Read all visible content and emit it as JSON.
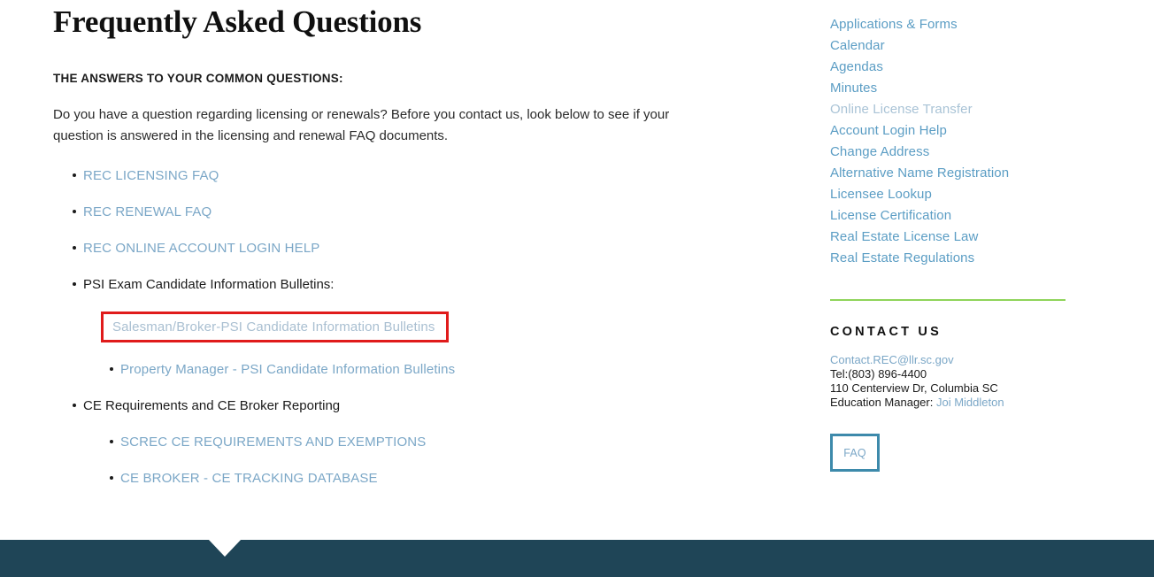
{
  "page": {
    "title": "Frequently Asked Questions",
    "subheading": "THE ANSWERS TO YOUR COMMON QUESTIONS:",
    "intro": "Do you have a question regarding licensing or renewals? Before you contact us, look below to see if your question is answered in the licensing and renewal FAQ documents."
  },
  "faq_list": [
    {
      "label": "REC LICENSING FAQ",
      "type": "link",
      "state": "normal"
    },
    {
      "label": "REC RENEWAL FAQ",
      "type": "link",
      "state": "normal"
    },
    {
      "label": "REC ONLINE ACCOUNT LOGIN HELP",
      "type": "link",
      "state": "normal"
    },
    {
      "label": "PSI Exam Candidate Information Bulletins:",
      "type": "text",
      "state": "normal"
    },
    {
      "label": "CE Requirements and CE Broker Reporting",
      "type": "text",
      "state": "normal"
    }
  ],
  "psi_sublist": [
    {
      "label": "Salesman/Broker-PSI Candidate Information Bulletins",
      "type": "link",
      "state": "muted",
      "highlighted": true
    },
    {
      "label": "Property Manager - PSI Candidate Information Bulletins",
      "type": "link",
      "state": "normal",
      "highlighted": false
    }
  ],
  "ce_sublist": [
    {
      "label": "SCREC CE REQUIREMENTS AND EXEMPTIONS",
      "type": "link",
      "state": "normal"
    },
    {
      "label": "CE BROKER - CE TRACKING DATABASE",
      "type": "link",
      "state": "normal"
    }
  ],
  "sidebar": {
    "links": [
      {
        "label": "Applications & Forms",
        "state": "normal"
      },
      {
        "label": "Calendar",
        "state": "normal"
      },
      {
        "label": "Agendas",
        "state": "normal"
      },
      {
        "label": "Minutes",
        "state": "normal"
      },
      {
        "label": "Online License Transfer",
        "state": "muted"
      },
      {
        "label": "Account Login Help",
        "state": "normal"
      },
      {
        "label": "Change Address",
        "state": "normal"
      },
      {
        "label": "Alternative Name Registration",
        "state": "normal"
      },
      {
        "label": "Licensee Lookup",
        "state": "normal"
      },
      {
        "label": "License Certification",
        "state": "normal"
      },
      {
        "label": "Real Estate License Law",
        "state": "normal"
      },
      {
        "label": "Real Estate Regulations",
        "state": "normal"
      }
    ],
    "contact": {
      "heading": "CONTACT US",
      "email": "Contact.REC@llr.sc.gov",
      "phone": "Tel:(803) 896-4400",
      "address": "110 Centerview Dr, Columbia SC",
      "education_manager_label": "Education Manager:",
      "education_manager_name": "Joi Middleton"
    },
    "faq_button_label": "FAQ"
  },
  "colors": {
    "link": "#7ba7c7",
    "link_muted": "#a9bfd1",
    "sidebar_link": "#5b9dc4",
    "green_rule": "#8fd45a",
    "footer": "#1f4557",
    "highlight_border": "#e01b1b",
    "button_border": "#3d8aab"
  }
}
